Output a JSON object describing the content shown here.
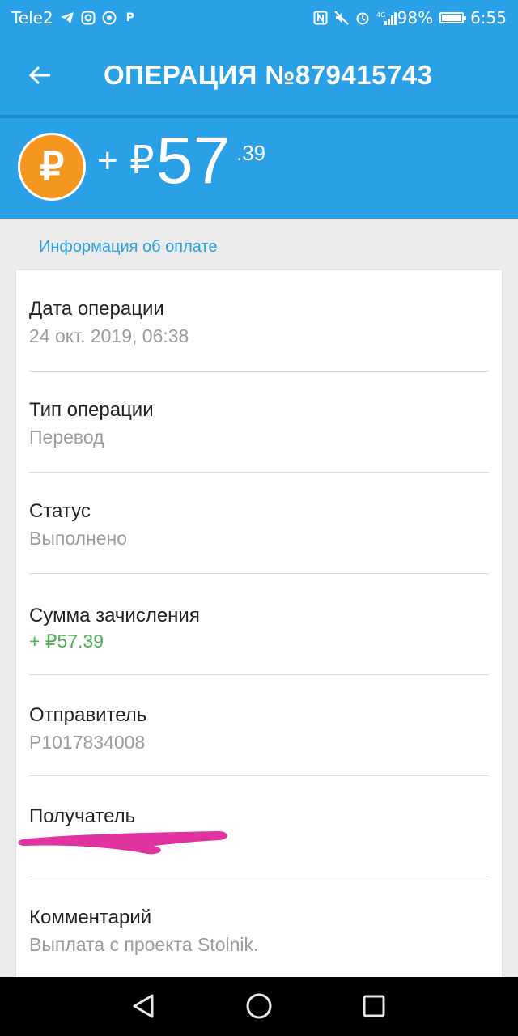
{
  "status_bar": {
    "carrier": "Tele2",
    "signal": "4G",
    "battery": "98%",
    "battery_level": 0.98,
    "time": "6:55",
    "icons": [
      "telegram-icon",
      "instagram-icon",
      "chrome-icon",
      "payeer-icon",
      "nfc-icon",
      "mute-icon",
      "alarm-icon",
      "signal-icon",
      "battery-icon"
    ]
  },
  "app_bar": {
    "title": "ОПЕРАЦИЯ №879415743",
    "back_icon": "arrow-left-icon"
  },
  "amount": {
    "sign": "+",
    "currency": "₽",
    "integer": "57",
    "decimal": ".39",
    "coin_symbol": "₽"
  },
  "section": {
    "title": "Информация об оплате"
  },
  "rows": [
    {
      "label": "Дата операции",
      "value": "24 окт. 2019, 06:38"
    },
    {
      "label": "Тип операции",
      "value": "Перевод"
    },
    {
      "label": "Статус",
      "value": "Выполнено"
    },
    {
      "label": "Сумма зачисления",
      "value": "+ ₽57.39"
    },
    {
      "label": "Отправитель",
      "value": "P1017834008"
    },
    {
      "label": "Получатель",
      "value": ""
    },
    {
      "label": "Комментарий",
      "value": "Выплата с проекта Stolnik."
    }
  ],
  "colors": {
    "primary": "#2aa0e6",
    "coin": "#f5961e",
    "positive": "#4caf50",
    "redaction": "#e0339f"
  }
}
